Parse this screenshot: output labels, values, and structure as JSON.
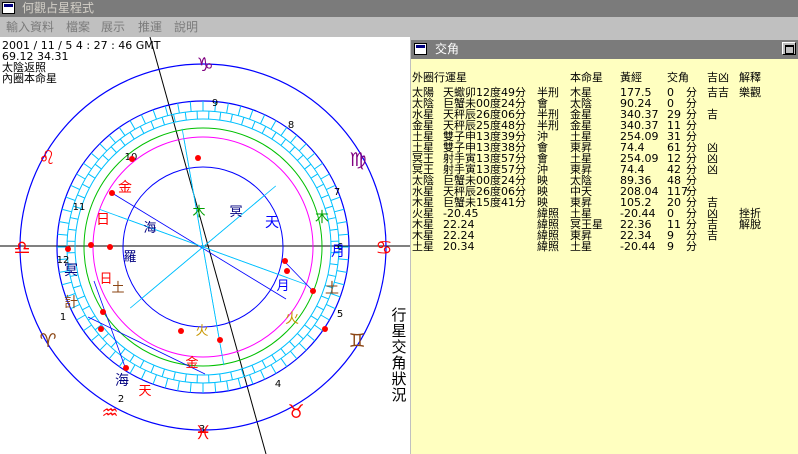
{
  "app": {
    "title": "何觀占星程式"
  },
  "menu": [
    "輸入資料",
    "檔案",
    "展示",
    "推運",
    "說明"
  ],
  "chart_info": {
    "datetime": "2001 / 11 / 5    4 : 27 : 46 GMT",
    "coords": "69.12    34.31",
    "line3": "太陰返照",
    "line4": "內圈本命星"
  },
  "side_label": "行星交角狀況",
  "wheel": {
    "signs": [
      {
        "glyph": "♑",
        "name": "capricorn-icon"
      },
      {
        "glyph": "♒",
        "name": "aquarius-icon"
      },
      {
        "glyph": "♓",
        "name": "pisces-icon"
      },
      {
        "glyph": "♈",
        "name": "aries-icon"
      },
      {
        "glyph": "♉",
        "name": "taurus-icon"
      },
      {
        "glyph": "♊",
        "name": "gemini-icon"
      },
      {
        "glyph": "♋",
        "name": "cancer-icon"
      },
      {
        "glyph": "♌",
        "name": "leo-icon"
      },
      {
        "glyph": "♍",
        "name": "virgo-icon"
      },
      {
        "glyph": "♎",
        "name": "libra-icon"
      }
    ],
    "house_numbers": [
      "1",
      "2",
      "3",
      "4",
      "5",
      "6",
      "7",
      "8",
      "9",
      "10",
      "11",
      "12"
    ],
    "outer_planets": [
      "月",
      "土",
      "火",
      "木",
      "金",
      "日",
      "冥",
      "計",
      "天",
      "海"
    ],
    "inner_planets": [
      "冥",
      "天",
      "木",
      "月",
      "土",
      "火",
      "金",
      "日",
      "羅",
      "海"
    ],
    "colors": {
      "sign_ring": "#0000ff",
      "cyan": "#00c0ff",
      "green": "#00c000",
      "magenta": "#ff00ff",
      "red": "#ff0000"
    }
  },
  "aspects": {
    "window_title": "交角",
    "headers": [
      "外圈行運星",
      "本命星",
      "黃經",
      "交角",
      "吉凶",
      "解釋"
    ],
    "rows": [
      [
        "太陽",
        "天蠍卯12度49分",
        "半刑",
        "木星",
        "177.5",
        "0",
        "分",
        "吉吉",
        "樂觀"
      ],
      [
        "太陰",
        "巨蟹未00度24分",
        "會",
        "太陰",
        "90.24",
        "0",
        "分",
        "",
        ""
      ],
      [
        "水星",
        "天秤辰26度06分",
        "半刑",
        "金星",
        "340.37",
        "29",
        "分",
        "吉",
        ""
      ],
      [
        "金星",
        "天秤辰25度48分",
        "半刑",
        "金星",
        "340.37",
        "11",
        "分",
        "",
        ""
      ],
      [
        "土星",
        "雙子申13度39分",
        "沖",
        "土星",
        "254.09",
        "31",
        "分",
        "",
        ""
      ],
      [
        "土星",
        "雙子申13度38分",
        "會",
        "東昇",
        "74.4",
        "61",
        "分",
        "凶",
        ""
      ],
      [
        "冥王",
        "射手寅13度57分",
        "會",
        "土星",
        "254.09",
        "12",
        "分",
        "凶",
        ""
      ],
      [
        "冥王",
        "射手寅13度57分",
        "沖",
        "東昇",
        "74.4",
        "42",
        "分",
        "凶",
        ""
      ],
      [
        "太陰",
        "巨蟹未00度24分",
        "映",
        "太陰",
        "89.36",
        "48",
        "分",
        "",
        ""
      ],
      [
        "水星",
        "天秤辰26度06分",
        "映",
        "中天",
        "208.04",
        "117",
        "分",
        "",
        ""
      ],
      [
        "木星",
        "巨蟹未15度41分",
        "映",
        "東昇",
        "105.2",
        "20",
        "分",
        "吉",
        ""
      ],
      [
        "火星",
        "-20.45",
        "緯照",
        "土星",
        "-20.44",
        "0",
        "分",
        "凶",
        "挫折"
      ],
      [
        "木星",
        "22.24",
        "緯照",
        "冥王星",
        "22.36",
        "11",
        "分",
        "吉",
        "解脫"
      ],
      [
        "木星",
        "22.24",
        "緯照",
        "東昇",
        "22.34",
        "9",
        "分",
        "吉",
        ""
      ],
      [
        "土星",
        "20.34",
        "緯照",
        "土星",
        "-20.44",
        "9",
        "分",
        "",
        ""
      ]
    ]
  }
}
